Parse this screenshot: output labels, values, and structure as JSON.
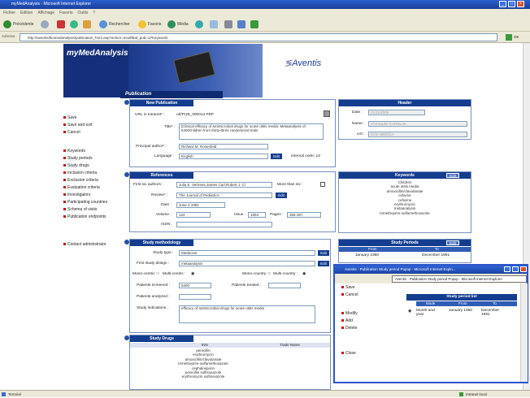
{
  "window": {
    "title": "myMedAnalysis - Microsoft Internet Explorer"
  },
  "menu": [
    "Fichier",
    "Edition",
    "Affichage",
    "Favoris",
    "Outils",
    "?"
  ],
  "toolbar": {
    "back": "Précédente",
    "search": "Rechercher",
    "favorites": "Favoris",
    "media": "Média"
  },
  "address": {
    "label": "Adresse",
    "url": "http://aventis/biomedanalysis/publication_form.asp?action=modif&id_pub=1#Keywords",
    "go": "OK"
  },
  "header": {
    "brand": "myMedAnalysis",
    "section": "Publication",
    "logo": "Aventis"
  },
  "sidebar": {
    "actions": [
      "Save",
      "Save and exit",
      "Cancel"
    ],
    "sections": [
      "Keywords",
      "Study periods",
      "Study drugs",
      "Inclusion criteria",
      "Exclusion criteria",
      "Evaluation criteria",
      "Investigators",
      "Participating countries",
      "Schema of visits",
      "Publication endpoints"
    ],
    "contact": "Contact administrator"
  },
  "new_publication": {
    "title": "New Publication",
    "url_label": "URL in Intranet* :",
    "url_value": "url/PUB_000014.PDF",
    "title_label": "Title* :",
    "title_value": "[Clinical efficacy of antimicrobial drugs for acute otitis media: Metaanalysis of 5400children from thirty-three randomized trials",
    "author_label": "Principal author* :",
    "author_value": "Richard M. Rosenfeld",
    "language_label": "Language :",
    "language_value": "English",
    "edit_btn": "Edit",
    "internal_code": "Internal code: 14"
  },
  "header_panel": {
    "title": "Header",
    "date_label": "Date :",
    "date_value": "21/11/2005",
    "name_label": "Name :",
    "name_value": "Christophe CARSLAK",
    "uo_label": "UO :",
    "uo_value": "DOC-MEDICA"
  },
  "references": {
    "title": "References",
    "authors_label": "First six authors :",
    "authors_value": "Julia E. Vertrees,James Carl,Robert J. Cl",
    "more_label": "More than six :",
    "review_label": "Review* :",
    "review_value": "The Journal of Pediatrics",
    "edit_btn": "Edit",
    "date_label": "Date :",
    "date_value": "June 4 1991",
    "volume_label": "Volume :",
    "volume_value": "124",
    "issue_label": "Issue :",
    "issue_value": "1994",
    "pages_label": "Pages :",
    "pages_value": "355-367",
    "issn_label": "ISSN :"
  },
  "keywords": {
    "title": "Keywords",
    "edit_btn": "Edit",
    "items": [
      "Children",
      "acute otitis media",
      "amoxicillin/clavulanate",
      "cefaclor",
      "cefixime",
      "erythromycin",
      "metaanalysis",
      "trimethoprim-sulfamethoxazole"
    ]
  },
  "methodology": {
    "title": "Study methodology",
    "type_label": "Study type :",
    "type_value": "Medecine",
    "design_label": "First study design :",
    "design_value": "metaanalysis",
    "edit_btn": "Edit",
    "mono_centric": "Mono-centric :",
    "multi_centric": "Multi-centric :",
    "mono_country": "Mono-country :",
    "multi_country": "Multi-country :",
    "screened_label": "Patients screened :",
    "screened_value": "5400",
    "treated_label": "Patients treated :",
    "analyzed_label": "Patients analyzed :",
    "indications_label": "Study indications :",
    "indications_value": "efficacy of antimicrobial drugs for acute otitis media"
  },
  "study_periods": {
    "title": "Study Periods",
    "edit_btn": "Edit",
    "col_from": "From",
    "col_to": "To",
    "from": "January 1960",
    "to": "December 1991"
  },
  "study_drugs": {
    "title": "Study Drugs",
    "col_inn": "INN",
    "col_trade": "Trade Name",
    "items": [
      "penicillin",
      "erythromycin",
      "amoxicillin/clavulanate",
      "trimethoprim-sulfamethoxazole",
      "cephalosporin",
      "penicillin sulfisoxazole",
      "erythromycin sulfisoxazole"
    ]
  },
  "popup": {
    "title": "Aventis - Publication Study period Popup - Microsoft Internet Explo...",
    "title2": "Aventis - Publication Study period Popup - Microsoft Internet Explorer",
    "actions1": [
      "Save",
      "Cancel"
    ],
    "actions2": [
      "Modify",
      "Add",
      "Delete"
    ],
    "close": "Close",
    "list_title": "Study period list",
    "col_mode": "Mode",
    "col_from": "From",
    "col_to": "To",
    "row_mode": "Month and year",
    "row_from": "January 1960",
    "row_to": "December 1991"
  },
  "status": {
    "left": "Terminé",
    "right": "Intranet local"
  }
}
